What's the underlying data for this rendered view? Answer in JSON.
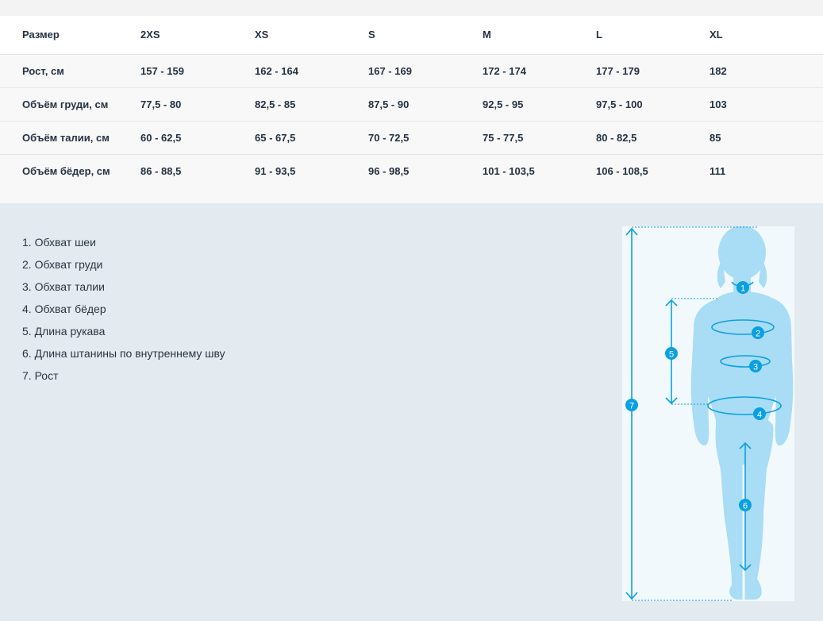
{
  "table": {
    "header": [
      "Размер",
      "2XS",
      "XS",
      "S",
      "M",
      "L",
      "XL"
    ],
    "rows": [
      [
        "Рост, см",
        "157 - 159",
        "162 - 164",
        "167 - 169",
        "172 - 174",
        "177 - 179",
        "182"
      ],
      [
        "Объём груди, см",
        "77,5 - 80",
        "82,5 - 85",
        "87,5 - 90",
        "92,5 - 95",
        "97,5 - 100",
        "103"
      ],
      [
        "Объём талии, см",
        "60 - 62,5",
        "65 - 67,5",
        "70 - 72,5",
        "75 - 77,5",
        "80 - 82,5",
        "85"
      ],
      [
        "Объём бёдер, см",
        "86 - 88,5",
        "91 - 93,5",
        "96 - 98,5",
        "101 - 103,5",
        "106 - 108,5",
        "111"
      ]
    ]
  },
  "legend": [
    "1. Обхват шеи",
    "2. Обхват груди",
    "3. Обхват талии",
    "4. Обхват бёдер",
    "5. Длина рукава",
    "6. Длина штанины по внутреннему шву",
    "7. Рост"
  ],
  "figure": {
    "markers": [
      "1",
      "2",
      "3",
      "4",
      "5",
      "6",
      "7"
    ],
    "colors": {
      "accent": "#0aa0e2",
      "silhouette": "#a9dcf5",
      "panel": "#f2f9fd"
    }
  }
}
